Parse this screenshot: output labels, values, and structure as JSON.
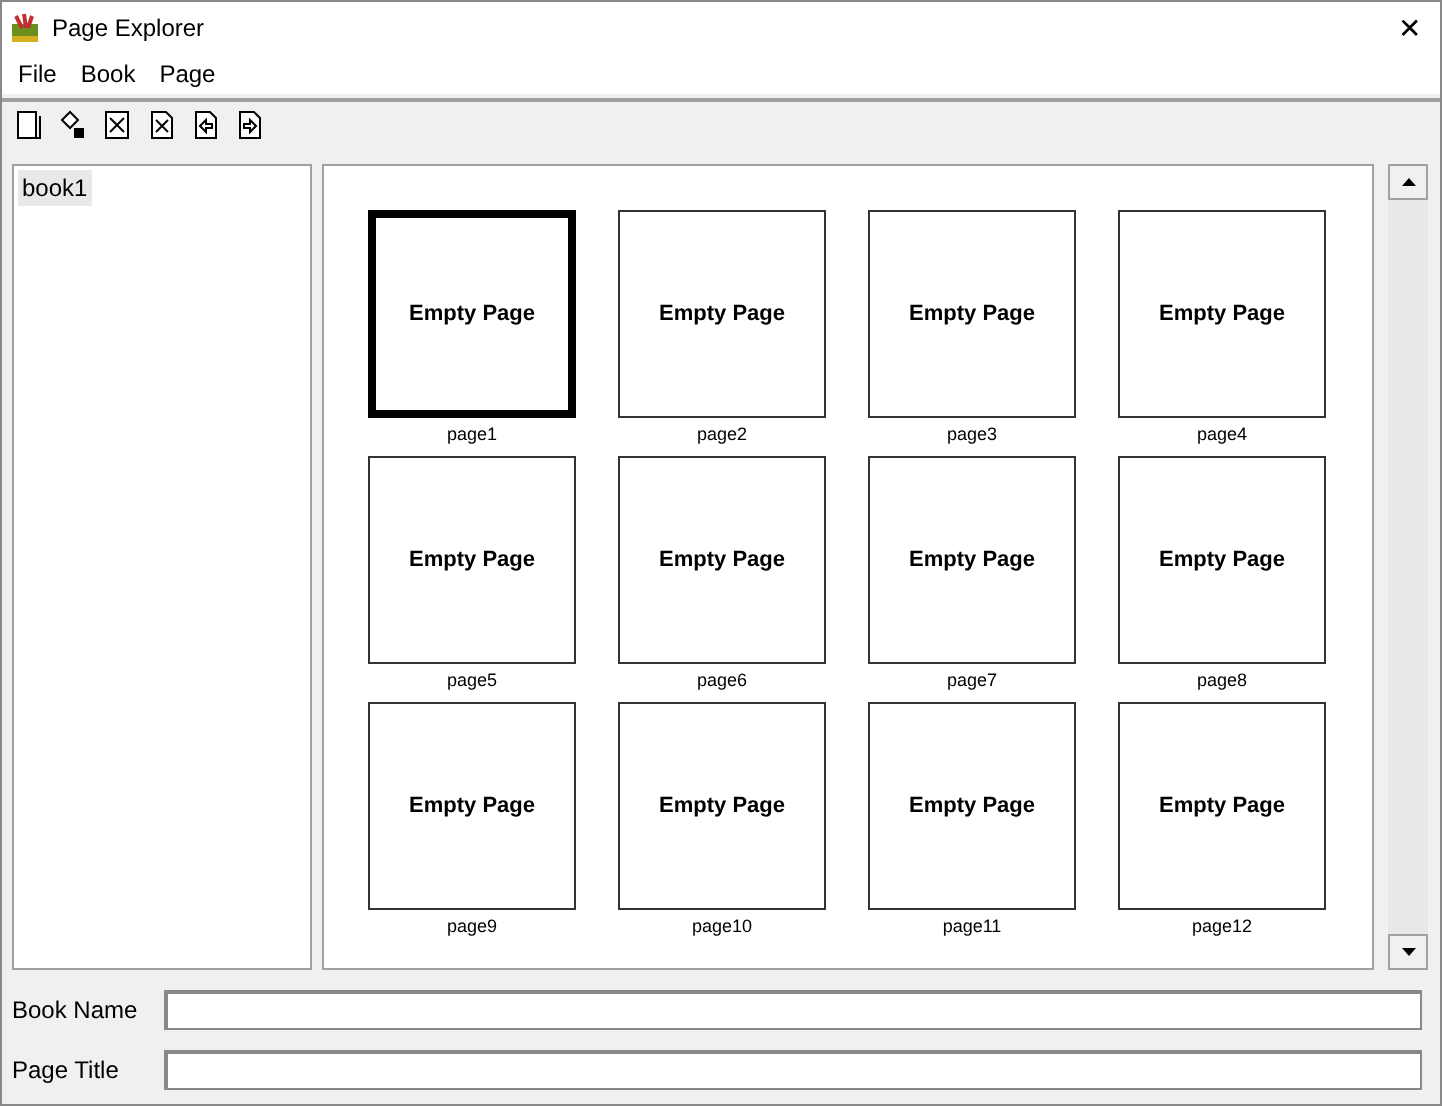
{
  "window": {
    "title": "Page Explorer",
    "close": "✕"
  },
  "menu": [
    {
      "label": "File"
    },
    {
      "label": "Book"
    },
    {
      "label": "Page"
    }
  ],
  "tree": {
    "items": [
      {
        "label": "book1",
        "selected": true
      }
    ]
  },
  "pages": [
    {
      "text": "Empty Page",
      "label": "page1",
      "selected": true
    },
    {
      "text": "Empty Page",
      "label": "page2",
      "selected": false
    },
    {
      "text": "Empty Page",
      "label": "page3",
      "selected": false
    },
    {
      "text": "Empty Page",
      "label": "page4",
      "selected": false
    },
    {
      "text": "Empty Page",
      "label": "page5",
      "selected": false
    },
    {
      "text": "Empty Page",
      "label": "page6",
      "selected": false
    },
    {
      "text": "Empty Page",
      "label": "page7",
      "selected": false
    },
    {
      "text": "Empty Page",
      "label": "page8",
      "selected": false
    },
    {
      "text": "Empty Page",
      "label": "page9",
      "selected": false
    },
    {
      "text": "Empty Page",
      "label": "page10",
      "selected": false
    },
    {
      "text": "Empty Page",
      "label": "page11",
      "selected": false
    },
    {
      "text": "Empty Page",
      "label": "page12",
      "selected": false
    }
  ],
  "fields": [
    {
      "label": "Book Name"
    },
    {
      "label": "Page Title"
    }
  ]
}
